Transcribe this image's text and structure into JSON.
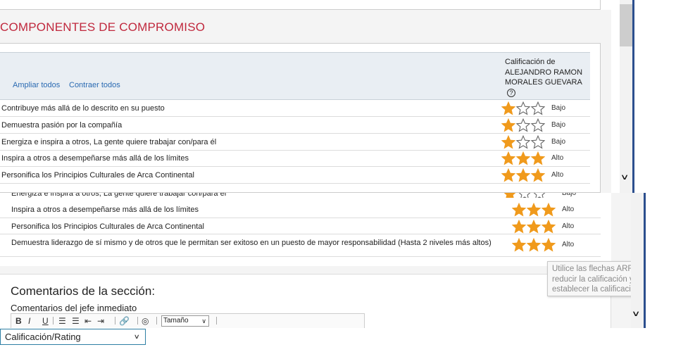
{
  "section": {
    "title": "COMPONENTES DE COMPROMISO"
  },
  "table": {
    "expand_all": "Ampliar todos",
    "collapse_all": "Contraer todos",
    "rating_header": [
      "Calificación de",
      "ALEJANDRO RAMON",
      "MORALES GUEVARA"
    ],
    "help_icon": "?",
    "rows": [
      {
        "label": "Contribuye más allá de lo descrito en su puesto",
        "stars": 1,
        "level": "Bajo"
      },
      {
        "label": "Demuestra pasión por la compañía",
        "stars": 1,
        "level": "Bajo"
      },
      {
        "label": "Energiza e inspira a otros, La gente quiere trabajar con/para él",
        "stars": 1,
        "level": "Bajo"
      },
      {
        "label": "Inspira a otros a desempeñarse más allá de los límites",
        "stars": 3,
        "level": "Alto"
      },
      {
        "label": "Personifica los Principios Culturales de Arca Continental",
        "stars": 3,
        "level": "Alto"
      }
    ]
  },
  "table2": {
    "partial_row": {
      "label": "Energiza e inspira a otros, La gente quiere trabajar con/para él",
      "level": "Bajo"
    },
    "rows": [
      {
        "label": "Inspira a otros a desempeñarse más allá de los límites",
        "stars": 3,
        "level": "Alto"
      },
      {
        "label": "Personifica los Principios Culturales de Arca Continental",
        "stars": 3,
        "level": "Alto"
      },
      {
        "label": "Demuestra liderazgo de sí mismo y de otros que le permitan ser exitoso en un puesto de mayor responsabilidad (Hasta 2 niveles más altos)",
        "stars": 3,
        "level": "Alto"
      }
    ]
  },
  "tooltip": {
    "lines": [
      "Utilice las flechas ARRIBA",
      "reducir la calificación y ut",
      "establecer la calificación n"
    ]
  },
  "comments": {
    "title": "Comentarios de la sección:",
    "subtitle": "Comentarios del jefe inmediato",
    "toolbar": {
      "bold": "B",
      "italic": "I",
      "underline": "U",
      "size_label": "Tamaño"
    }
  },
  "rating_select": {
    "value": "Calificación/Rating"
  },
  "colors": {
    "accent_title": "#c0283d",
    "link": "#2a6ab2",
    "star_fill": "#f09a1c",
    "header_bg": "#e9eef3"
  }
}
